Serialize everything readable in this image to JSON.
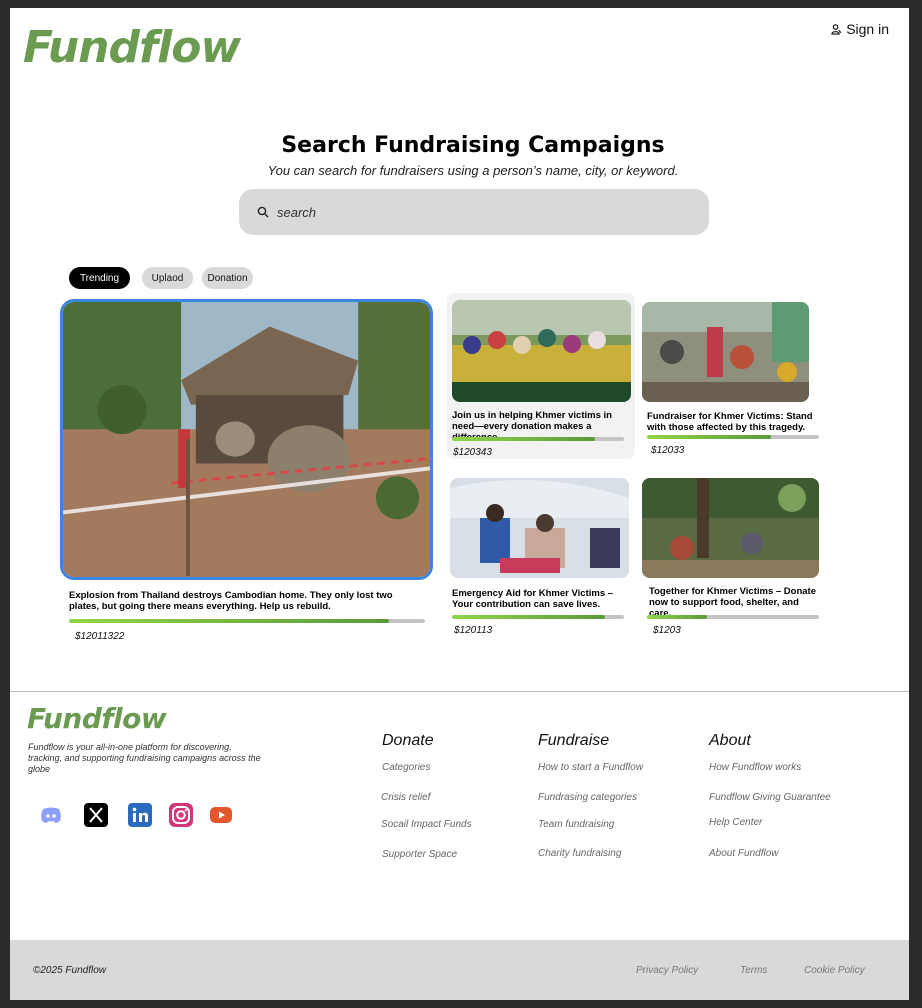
{
  "brand": {
    "name": "Fundflow",
    "color": "#6a9b51"
  },
  "header": {
    "sign_in_label": "Sign in",
    "sign_in_icon": "user-icon"
  },
  "hero": {
    "title": "Search Fundraising Campaigns",
    "subtitle": "You can search for fundraisers using a person’s name, city, or keyword.",
    "search_placeholder": "search",
    "search_icon": "search-icon"
  },
  "filters": [
    {
      "label": "Trending",
      "active": true
    },
    {
      "label": "Uplaod",
      "active": false
    },
    {
      "label": "Donation",
      "active": false
    }
  ],
  "campaigns": [
    {
      "title": "Explosion from Thailand destroys Cambodian home. They only lost two plates, but going there means everything. Help us rebuild.",
      "amount": "$12011322",
      "progress": 0.9,
      "featured": true
    },
    {
      "title": "Join us in helping Khmer victims in need—every donation makes a difference",
      "amount": "$120343",
      "progress": 0.83,
      "featured": false
    },
    {
      "title": "Fundraiser for Khmer Victims: Stand with those affected by this tragedy.",
      "amount": "$12033",
      "progress": 0.72,
      "featured": false
    },
    {
      "title": "Emergency Aid for Khmer Victims – Your contribution can save lives.",
      "amount": "$120113",
      "progress": 0.89,
      "featured": false
    },
    {
      "title": "Together for Khmer Victims – Donate now to support food, shelter, and care.",
      "amount": "$1203",
      "progress": 0.35,
      "featured": false
    }
  ],
  "footer": {
    "logo": "Fundflow",
    "description": "Fundflow is your all-in-one platform for discovering, tracking, and supporting fundraising campaigns across the globe",
    "socials": [
      "discord-icon",
      "x-icon",
      "linkedin-icon",
      "instagram-icon",
      "youtube-icon"
    ],
    "columns": [
      {
        "heading": "Donate",
        "links": [
          "Categories",
          "Crisis relief",
          "Socail Impact Funds",
          "Supporter Space"
        ]
      },
      {
        "heading": "Fundraise",
        "links": [
          "How to start a Fundflow",
          "Fundrasing categories",
          "Team fundraising",
          "Charity fundraising"
        ]
      },
      {
        "heading": "About",
        "links": [
          "How Fundflow works",
          "Fundflow Giving Guarantee",
          "Help Center",
          "About Fundflow"
        ]
      }
    ],
    "copyright": "2025 Fundflow",
    "bottom_links": [
      "Privacy Policy",
      "Terms",
      "Cookie Policy"
    ]
  }
}
